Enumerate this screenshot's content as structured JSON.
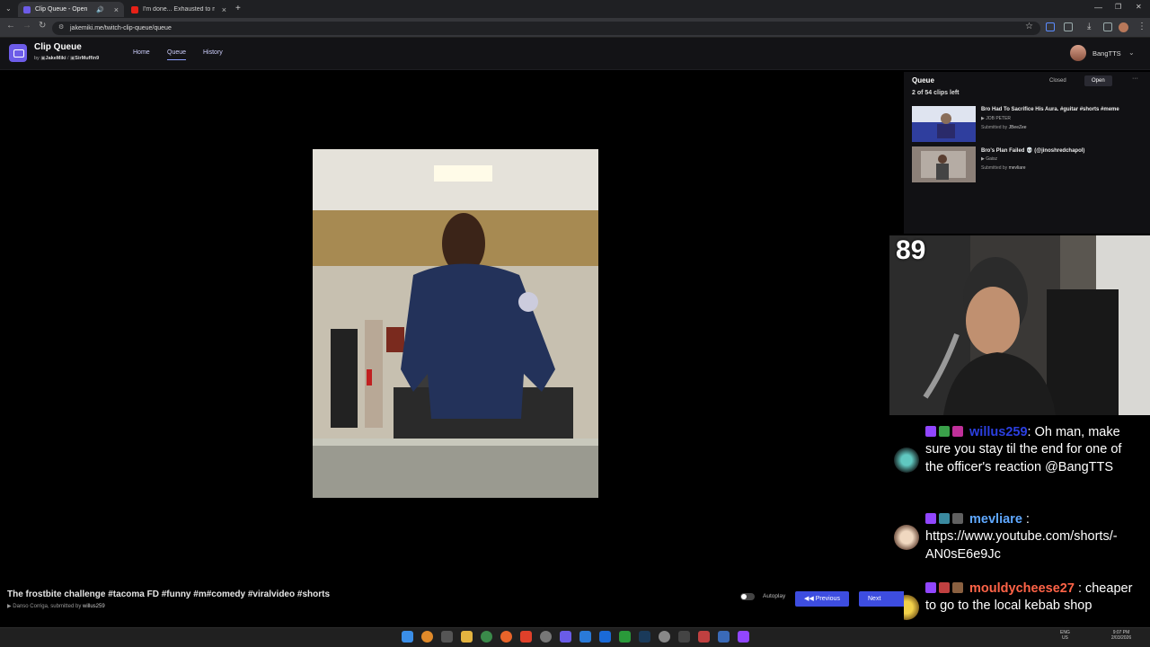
{
  "browser": {
    "tabs": [
      {
        "title": "Clip Queue - Open",
        "active": true
      },
      {
        "title": "I'm done... Exhausted to my lim",
        "active": false
      }
    ],
    "new_tab": "+",
    "url": "jakemiki.me/twitch-clip-queue/queue",
    "window_controls": [
      "—",
      "❐",
      "✕"
    ]
  },
  "app": {
    "title": "Clip Queue",
    "by_prefix": "by",
    "author1": "JakeMiki",
    "separator": "/",
    "author2": "SirMuffin9",
    "nav": [
      "Home",
      "Queue",
      "History"
    ],
    "active_nav": "Queue",
    "username": "BangTTS"
  },
  "queue": {
    "heading": "Queue",
    "count_text": "2 of 54 clips left",
    "closed_label": "Closed",
    "open_label": "Open",
    "more": "···",
    "items": [
      {
        "title": "Bro Had To Sacrifice His Aura. #guitar #shorts #meme",
        "channel": "JOB PETER",
        "submitted_prefix": "Submitted by",
        "submitter": "JBeeZee"
      },
      {
        "title": "Bro's Plan Failed 💀 (@jinoshredchapol)",
        "channel": "Gaisz",
        "submitted_prefix": "Submitted by",
        "submitter": "mevliare"
      }
    ]
  },
  "current_clip": {
    "title": "The frostbite challenge #tacoma FD #funny #m#comedy #viralvideo #shorts",
    "channel": "Danso Corriga",
    "submitted_prefix": ", submitted by",
    "submitter": "willus259",
    "autoplay_label": "Autoplay",
    "autoplay_on": false,
    "prev_label": "Previous",
    "next_label": "Next"
  },
  "overlay": {
    "counter": "89",
    "chat": [
      {
        "user": "willus259",
        "user_color": "#2b3fe0",
        "sep": ":",
        "text": " Oh man, make sure you stay til the end for one of the officer's reaction @BangTTS"
      },
      {
        "user": "mevliare",
        "user_color": "#5fa8ff",
        "sep": ":",
        "text": " https://www.youtube.com/shorts/-AN0sE6e9Jc"
      },
      {
        "user": "mouldycheese27",
        "user_color": "#ff6347",
        "sep": ":",
        "text": " cheaper to go to the local kebab shop"
      }
    ]
  },
  "taskbar": {
    "lang": "ENG",
    "region": "US",
    "time": "9:07 PM",
    "date": "2/03/2026"
  },
  "colors": {
    "accent": "#3d4de0",
    "logo": "#6d5ce8",
    "twitch": "#9146ff"
  }
}
